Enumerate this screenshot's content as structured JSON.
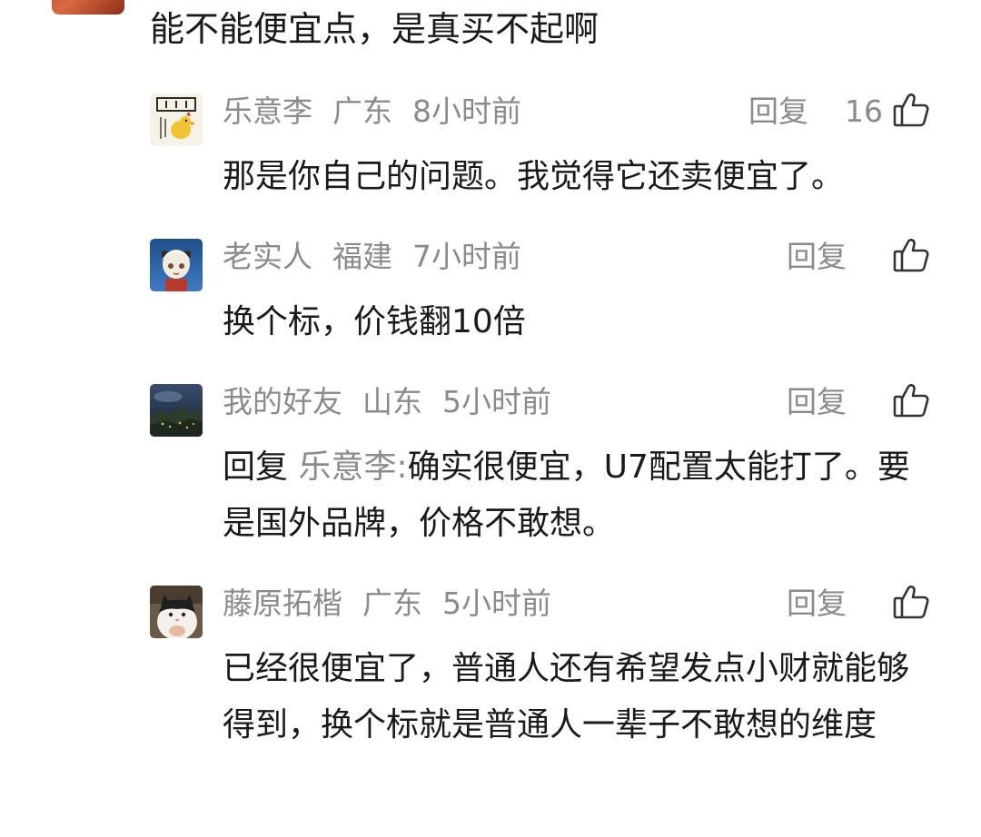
{
  "top_comment": {
    "text": "能不能便宜点，是真买不起啊"
  },
  "icons": {
    "like": "thumbs-up-outline-icon"
  },
  "replies": [
    {
      "user": "乐意李",
      "location": "广东",
      "time": "8小时前",
      "reply_label": "回复",
      "likes": "16",
      "text": "那是你自己的问题。我觉得它还卖便宜了。"
    },
    {
      "user": "老实人",
      "location": "福建",
      "time": "7小时前",
      "reply_label": "回复",
      "likes": "",
      "text": "换个标，价钱翻10倍"
    },
    {
      "user": "我的好友",
      "location": "山东",
      "time": "5小时前",
      "reply_label": "回复",
      "likes": "",
      "reply_prefix": "回复",
      "mention": "乐意李:",
      "text": "确实很便宜，U7配置太能打了。要是国外品牌，价格不敢想。"
    },
    {
      "user": "藤原拓楷",
      "location": "广东",
      "time": "5小时前",
      "reply_label": "回复",
      "likes": "",
      "text": "已经很便宜了，普通人还有希望发点小财就能够得到，换个标就是普通人一辈子不敢想的维度"
    }
  ]
}
